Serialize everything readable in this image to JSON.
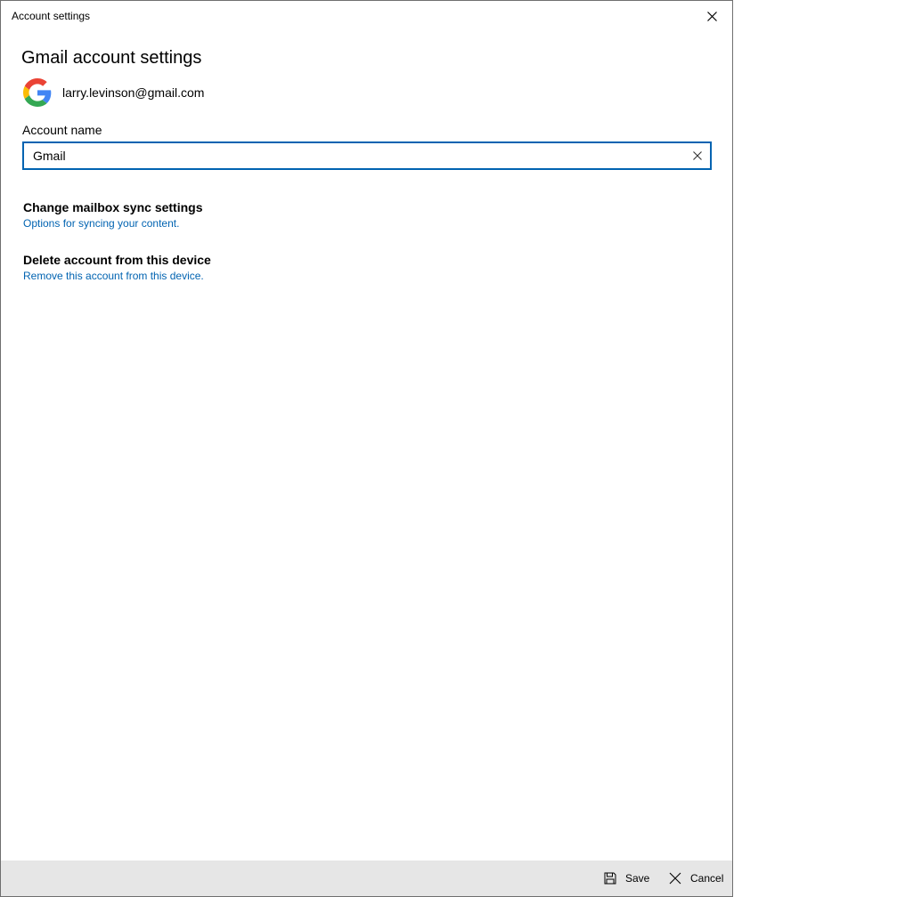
{
  "window": {
    "title": "Account settings"
  },
  "main": {
    "heading": "Gmail account settings",
    "email": "larry.levinson@gmail.com",
    "account_name_label": "Account name",
    "account_name_value": "Gmail"
  },
  "sections": {
    "sync": {
      "title": "Change mailbox sync settings",
      "link": "Options for syncing your content."
    },
    "delete": {
      "title": "Delete account from this device",
      "link": "Remove this account from this device."
    }
  },
  "footer": {
    "save_label": "Save",
    "cancel_label": "Cancel"
  },
  "icons": {
    "close": "close-icon",
    "clear": "clear-icon",
    "save": "save-icon",
    "cancel": "cancel-icon",
    "account": "google-logo-icon"
  },
  "colors": {
    "accent": "#0063b1",
    "footer_bg": "#e6e6e6",
    "link": "#0063b1"
  }
}
